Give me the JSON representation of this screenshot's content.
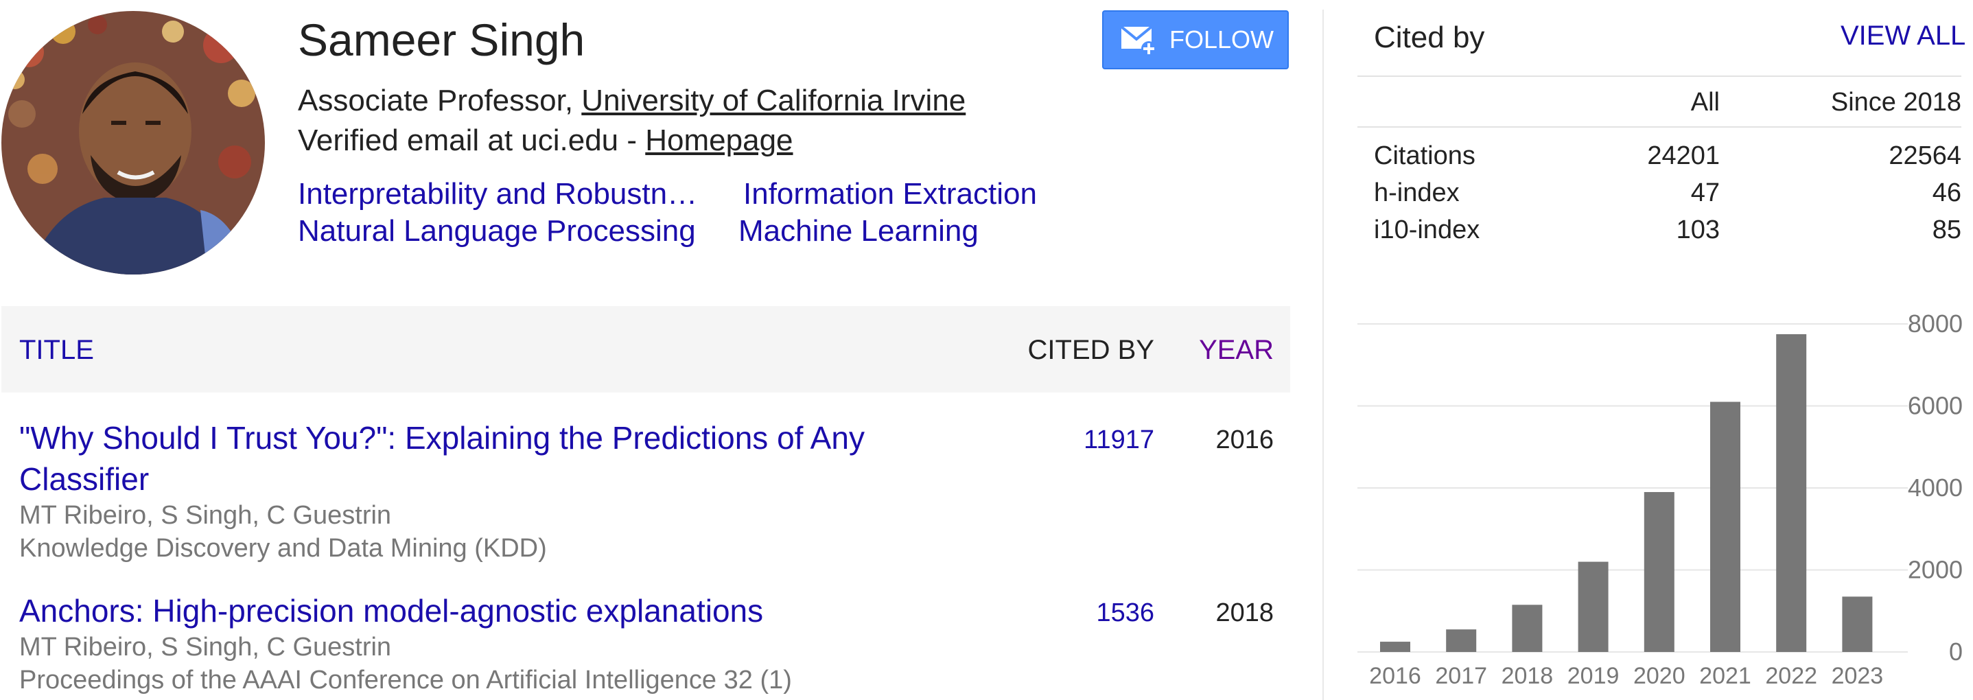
{
  "profile": {
    "name": "Sameer Singh",
    "position": "Associate Professor, ",
    "university": "University of California Irvine",
    "email_text": "Verified email at uci.edu - ",
    "homepage": "Homepage",
    "interests": [
      "Interpretability and Robustn…",
      "Information Extraction",
      "Natural Language Processing",
      "Machine Learning"
    ],
    "follow_label": "FOLLOW"
  },
  "table": {
    "headers": {
      "title": "TITLE",
      "cited_by": "CITED BY",
      "year": "YEAR"
    },
    "rows": [
      {
        "title_line1": "\"Why Should I Trust You?\": Explaining the Predictions of Any",
        "title_line2": "Classifier",
        "authors": "MT Ribeiro, S Singh, C Guestrin",
        "venue": "Knowledge Discovery and Data Mining (KDD)",
        "cited_by": "11917",
        "year": "2016"
      },
      {
        "title_line1": "Anchors: High-precision model-agnostic explanations",
        "title_line2": "",
        "authors": "MT Ribeiro, S Singh, C Guestrin",
        "venue": "Proceedings of the AAAI Conference on Artificial Intelligence 32 (1)",
        "cited_by": "1536",
        "year": "2018"
      }
    ]
  },
  "cited_by": {
    "title": "Cited by",
    "view_all": "VIEW ALL",
    "columns": [
      "All",
      "Since 2018"
    ],
    "rows": [
      {
        "label": "Citations",
        "all": "24201",
        "since": "22564"
      },
      {
        "label": "h-index",
        "all": "47",
        "since": "46"
      },
      {
        "label": "i10-index",
        "all": "103",
        "since": "85"
      }
    ]
  },
  "chart_data": {
    "type": "bar",
    "categories": [
      "2016",
      "2017",
      "2018",
      "2019",
      "2020",
      "2021",
      "2022",
      "2023"
    ],
    "values": [
      250,
      550,
      1150,
      2200,
      3900,
      6100,
      7750,
      1350
    ],
    "ylim": [
      0,
      8000
    ],
    "yticks": [
      "0",
      "2000",
      "4000",
      "6000",
      "8000"
    ],
    "bar_color": "#777777"
  },
  "colors": {
    "link": "#1a0dab",
    "follow_button": "#4d90fe",
    "header_bg": "#f5f5f5"
  }
}
